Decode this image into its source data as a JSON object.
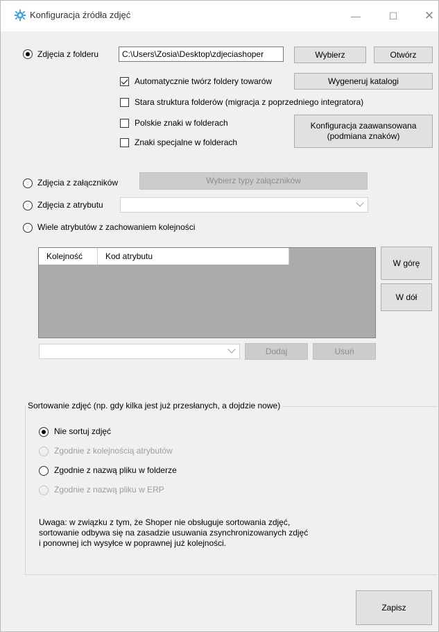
{
  "window": {
    "title": "Konfiguracja źródła zdjęć",
    "icon": "gear-icon",
    "controls": {
      "minimize": "—",
      "maximize": "☐",
      "close": "✕"
    }
  },
  "source_folder": {
    "label": "Zdjęcia z folderu",
    "selected": true,
    "path": "C:\\Users\\Zosia\\Desktop\\zdjeciashoper",
    "choose_button": "Wybierz",
    "open_button": "Otwórz",
    "options": {
      "auto_create": {
        "label": "Automatycznie twórz foldery towarów",
        "checked": true
      },
      "old_structure": {
        "label": "Stara struktura folderów (migracja z poprzedniego integratora)",
        "checked": false
      },
      "polish_chars": {
        "label": "Polskie znaki w folderach",
        "checked": false
      },
      "special_chars": {
        "label": "Znaki specjalne w folderach",
        "checked": false
      }
    },
    "generate_button": "Wygeneruj katalogi",
    "advanced_button_line1": "Konfiguracja zaawansowana",
    "advanced_button_line2": "(podmiana znaków)"
  },
  "source_attachments": {
    "label": "Zdjęcia z załączników",
    "selected": false,
    "button": "Wybierz typy załączników"
  },
  "source_attribute": {
    "label": "Zdjęcia z atrybutu",
    "selected": false,
    "value": ""
  },
  "source_multi_attributes": {
    "label": "Wiele atrybutów z zachowaniem kolejności",
    "selected": false,
    "columns": [
      "Kolejność",
      "Kod atrybutu"
    ],
    "rows": [],
    "up_button": "W górę",
    "down_button": "W dół",
    "add_button": "Dodaj",
    "remove_button": "Usuń",
    "combo_value": ""
  },
  "sorting": {
    "title": "Sortowanie zdjęć (np. gdy kilka jest już przesłanych, a dojdzie nowe)",
    "options": [
      {
        "label": "Nie sortuj zdjęć",
        "selected": true,
        "enabled": true
      },
      {
        "label": "Zgodnie z kolejnością atrybutów",
        "selected": false,
        "enabled": false
      },
      {
        "label": "Zgodnie z nazwą pliku w folderze",
        "selected": false,
        "enabled": true
      },
      {
        "label": "Zgodnie z nazwą pliku w ERP",
        "selected": false,
        "enabled": false
      }
    ],
    "note_line1": "Uwaga: w związku z tym, że Shoper nie obsługuje sortowania zdjęć,",
    "note_line2": "sortowanie odbywa się na zasadzie usuwania zsynchronizowanych zdjęć",
    "note_line3": "i ponownej ich wysyłce w poprawnej już kolejności."
  },
  "save_button": "Zapisz"
}
